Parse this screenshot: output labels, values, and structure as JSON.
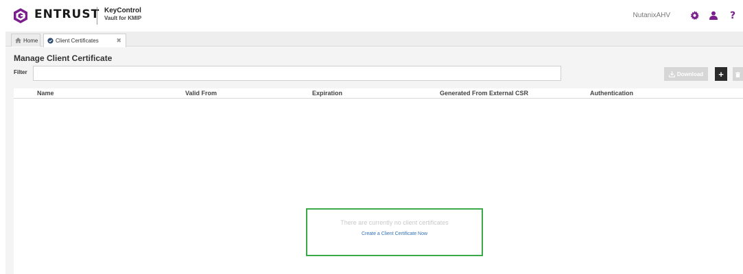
{
  "header": {
    "brand": "ENTRUST",
    "product_line1": "KeyControl",
    "product_line2": "Vault for KMIP",
    "username": "NutanixAHV",
    "icons": [
      "gear-icon",
      "user-icon",
      "help-icon"
    ],
    "accent_color": "#7b1f8c"
  },
  "tabs": [
    {
      "label": "Home",
      "icon": "home-icon",
      "active": false
    },
    {
      "label": "Client Certificates",
      "icon": "certificate-icon",
      "active": true,
      "closable": true
    }
  ],
  "main": {
    "title": "Manage Client Certificate",
    "filter_label": "Filter",
    "filter_value": "",
    "download_label": "Download",
    "add_label": "+",
    "table": {
      "columns": [
        "Name",
        "Valid From",
        "Expiration",
        "Generated From External CSR",
        "Authentication"
      ],
      "rows": []
    },
    "empty_state": {
      "message": "There are currently no client certificates",
      "link": "Create a Client Certificate Now"
    }
  },
  "colors": {
    "empty_state_border": "#3aa846",
    "link": "#2f6fb6",
    "add_button": "#2b2b2b",
    "disabled_button": "#d6d6d6"
  }
}
